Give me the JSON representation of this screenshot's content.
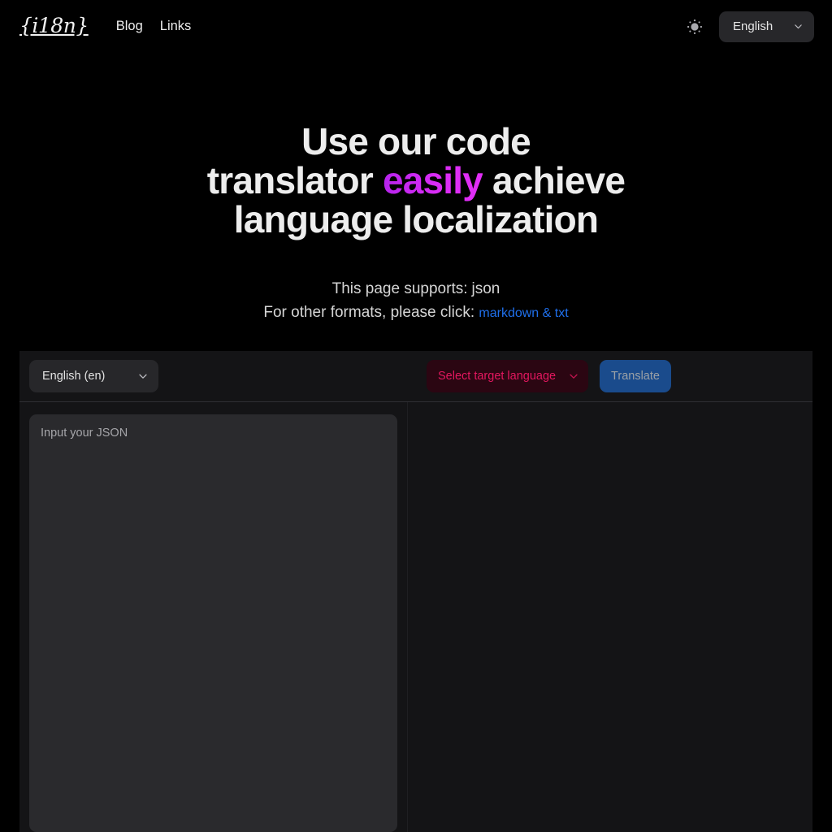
{
  "nav": {
    "brand": "{i18n}",
    "links": [
      {
        "label": "Blog",
        "name": "nav-link-blog"
      },
      {
        "label": "Links",
        "name": "nav-link-links"
      }
    ],
    "theme_icon": "sun-icon",
    "language_selector": {
      "value": "English",
      "chevron_icon": "chevron-down-icon"
    }
  },
  "hero": {
    "title_line1": "Use our code",
    "title_line2_pre": "translator ",
    "title_accent": "easily",
    "title_line2_post": " achieve",
    "title_line3": "language localization",
    "supports_prefix": "This page supports:",
    "supports_format": "json",
    "other_formats_prefix": "For other formats, please click:",
    "other_formats_link": "markdown & txt",
    "accent_color": "#d42bf2",
    "link_color": "#1f6feb"
  },
  "workspace": {
    "source_language": {
      "value": "English (en)",
      "chevron_icon": "chevron-down-icon"
    },
    "target_language": {
      "value": "Select target language",
      "chevron_icon": "chevron-down-icon",
      "text_color": "#e4175f",
      "background_color": "#2b0612"
    },
    "translate_button": {
      "label": "Translate",
      "background_color": "#1a4b8c",
      "text_color": "#9aa0a6"
    },
    "input_editor": {
      "placeholder": "Input your JSON",
      "value": ""
    },
    "output_editor": {
      "value": ""
    }
  }
}
